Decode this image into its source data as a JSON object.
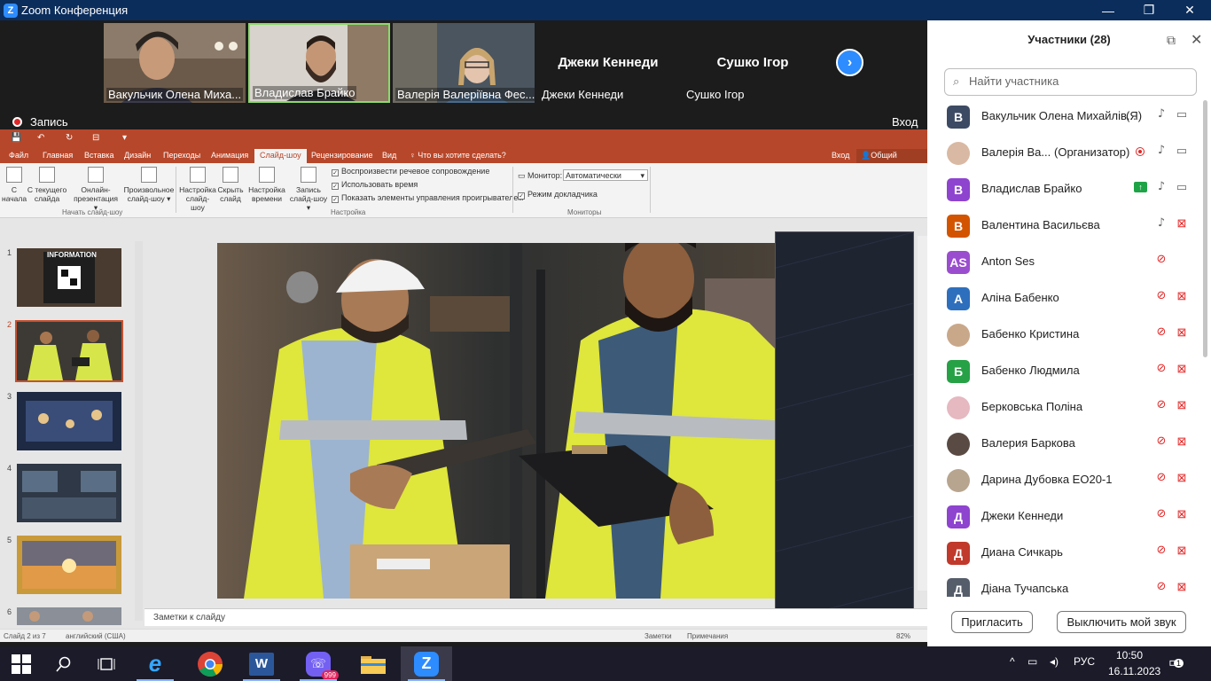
{
  "window": {
    "title": "Zoom Конференция",
    "minimize": "—",
    "restore": "❐",
    "close": "✕"
  },
  "video_strip": [
    {
      "name": "Вакульчик Олена Миха...",
      "has_video": true
    },
    {
      "name": "Владислав Брайко",
      "has_video": true,
      "active_speaker": true
    },
    {
      "name": "Валерія Валеріївна Фес...",
      "has_video": true
    },
    {
      "name": "Джеки Кеннеди",
      "big_name": "Джеки Кеннеди",
      "has_video": false,
      "muted": true
    },
    {
      "name": "Сушко Ігор",
      "big_name": "Сушко Ігор",
      "has_video": false,
      "muted": true
    }
  ],
  "next_icon": "›",
  "recording": {
    "label": "Запись",
    "signin": "Вход"
  },
  "ppt": {
    "qat": {
      "save": "💾",
      "undo": "↶",
      "redo": "↻",
      "present": "⊟",
      "more": "▾"
    },
    "tabs": [
      "Файл",
      "Главная",
      "Вставка",
      "Дизайн",
      "Переходы",
      "Анимация",
      "Слайд-шоу",
      "Рецензирование",
      "Вид"
    ],
    "active_tab": "Слайд-шоу",
    "tell_me": "Что вы хотите сделать?",
    "signin": "Вход",
    "share": "Общий доступ",
    "ribbon": {
      "from_start": "С начала",
      "from_current": "С текущего слайда",
      "online": "Онлайн-презентация ▾",
      "custom": "Произвольное слайд-шоу ▾",
      "group1": "Начать слайд-шоу",
      "setup": "Настройка слайд-шоу",
      "hide": "Скрыть слайд",
      "timings": "Настройка времени",
      "record": "Запись слайд-шоу ▾",
      "chk_narration": "Воспроизвести речевое сопровождение",
      "chk_timings": "Использовать время",
      "chk_controls": "Показать элементы управления проигрывателем",
      "group2": "Настройка",
      "monitor_label": "Монитор:",
      "monitor_value": "Автоматически",
      "presenter_view": "Режим докладчика",
      "group3": "Мониторы"
    },
    "thumbnails": [
      {
        "num": "1",
        "title": "INFORMATION"
      },
      {
        "num": "2",
        "selected": true
      },
      {
        "num": "3"
      },
      {
        "num": "4"
      },
      {
        "num": "5"
      },
      {
        "num": "6"
      }
    ],
    "notes_placeholder": "Заметки к слайду",
    "status": {
      "slide": "Слайд 2 из 7",
      "lang": "английский (США)",
      "notes": "Заметки",
      "comments": "Примечания",
      "zoom": "82%"
    }
  },
  "participants_panel": {
    "title": "Участники (28)",
    "popout_icon": "⧉",
    "close_icon": "✕",
    "search_placeholder": "Найти участника",
    "participants": [
      {
        "initial": "В",
        "color": "#3d4a63",
        "name": "Вакульчик Олена Михайлів...",
        "role": "(Я)",
        "mic": "on",
        "cam": "on"
      },
      {
        "initial": "",
        "color": "#d9b9a3",
        "name": "Валерія Ва...",
        "role": "(Организатор)",
        "recording": true,
        "mic": "on",
        "cam": "on"
      },
      {
        "initial": "В",
        "color": "#8e44cf",
        "name": "Владислав Брайко",
        "sharing": true,
        "mic": "on",
        "cam": "on"
      },
      {
        "initial": "В",
        "color": "#d35400",
        "name": "Валентина Васильєва",
        "mic": "on",
        "cam": "off"
      },
      {
        "initial": "AS",
        "color": "#9b4dcf",
        "name": "Anton Ses",
        "mic": "off",
        "cam": ""
      },
      {
        "initial": "А",
        "color": "#2e6fbd",
        "name": "Аліна Бабенко",
        "mic": "off",
        "cam": "off"
      },
      {
        "initial": "",
        "color": "#c9a88a",
        "name": "Бабенко Кристина",
        "mic": "off",
        "cam": "off"
      },
      {
        "initial": "Б",
        "color": "#27a146",
        "name": "Бабенко Людмила",
        "mic": "off",
        "cam": "off"
      },
      {
        "initial": "",
        "color": "#e6b8c0",
        "name": "Берковська Поліна",
        "mic": "off",
        "cam": "off"
      },
      {
        "initial": "",
        "color": "#5a4a44",
        "name": "Валерия Баркова",
        "mic": "off",
        "cam": "off"
      },
      {
        "initial": "",
        "color": "#b8a58f",
        "name": "Дарина Дубовка ЕО20-1",
        "mic": "off",
        "cam": "off"
      },
      {
        "initial": "Д",
        "color": "#8e44cf",
        "name": "Джеки Кеннеди",
        "mic": "off",
        "cam": "off"
      },
      {
        "initial": "Д",
        "color": "#c0392b",
        "name": "Диана Сичкарь",
        "mic": "off",
        "cam": "off"
      },
      {
        "initial": "Д",
        "color": "#555d6b",
        "name": "Діана Тучапська",
        "mic": "off",
        "cam": "off"
      }
    ],
    "invite": "Пригласить",
    "mute_me": "Выключить мой звук"
  },
  "taskbar": {
    "lang": "РУС",
    "time": "10:50",
    "date": "16.11.2023",
    "notif_count": "1",
    "viber_badge": "999"
  }
}
